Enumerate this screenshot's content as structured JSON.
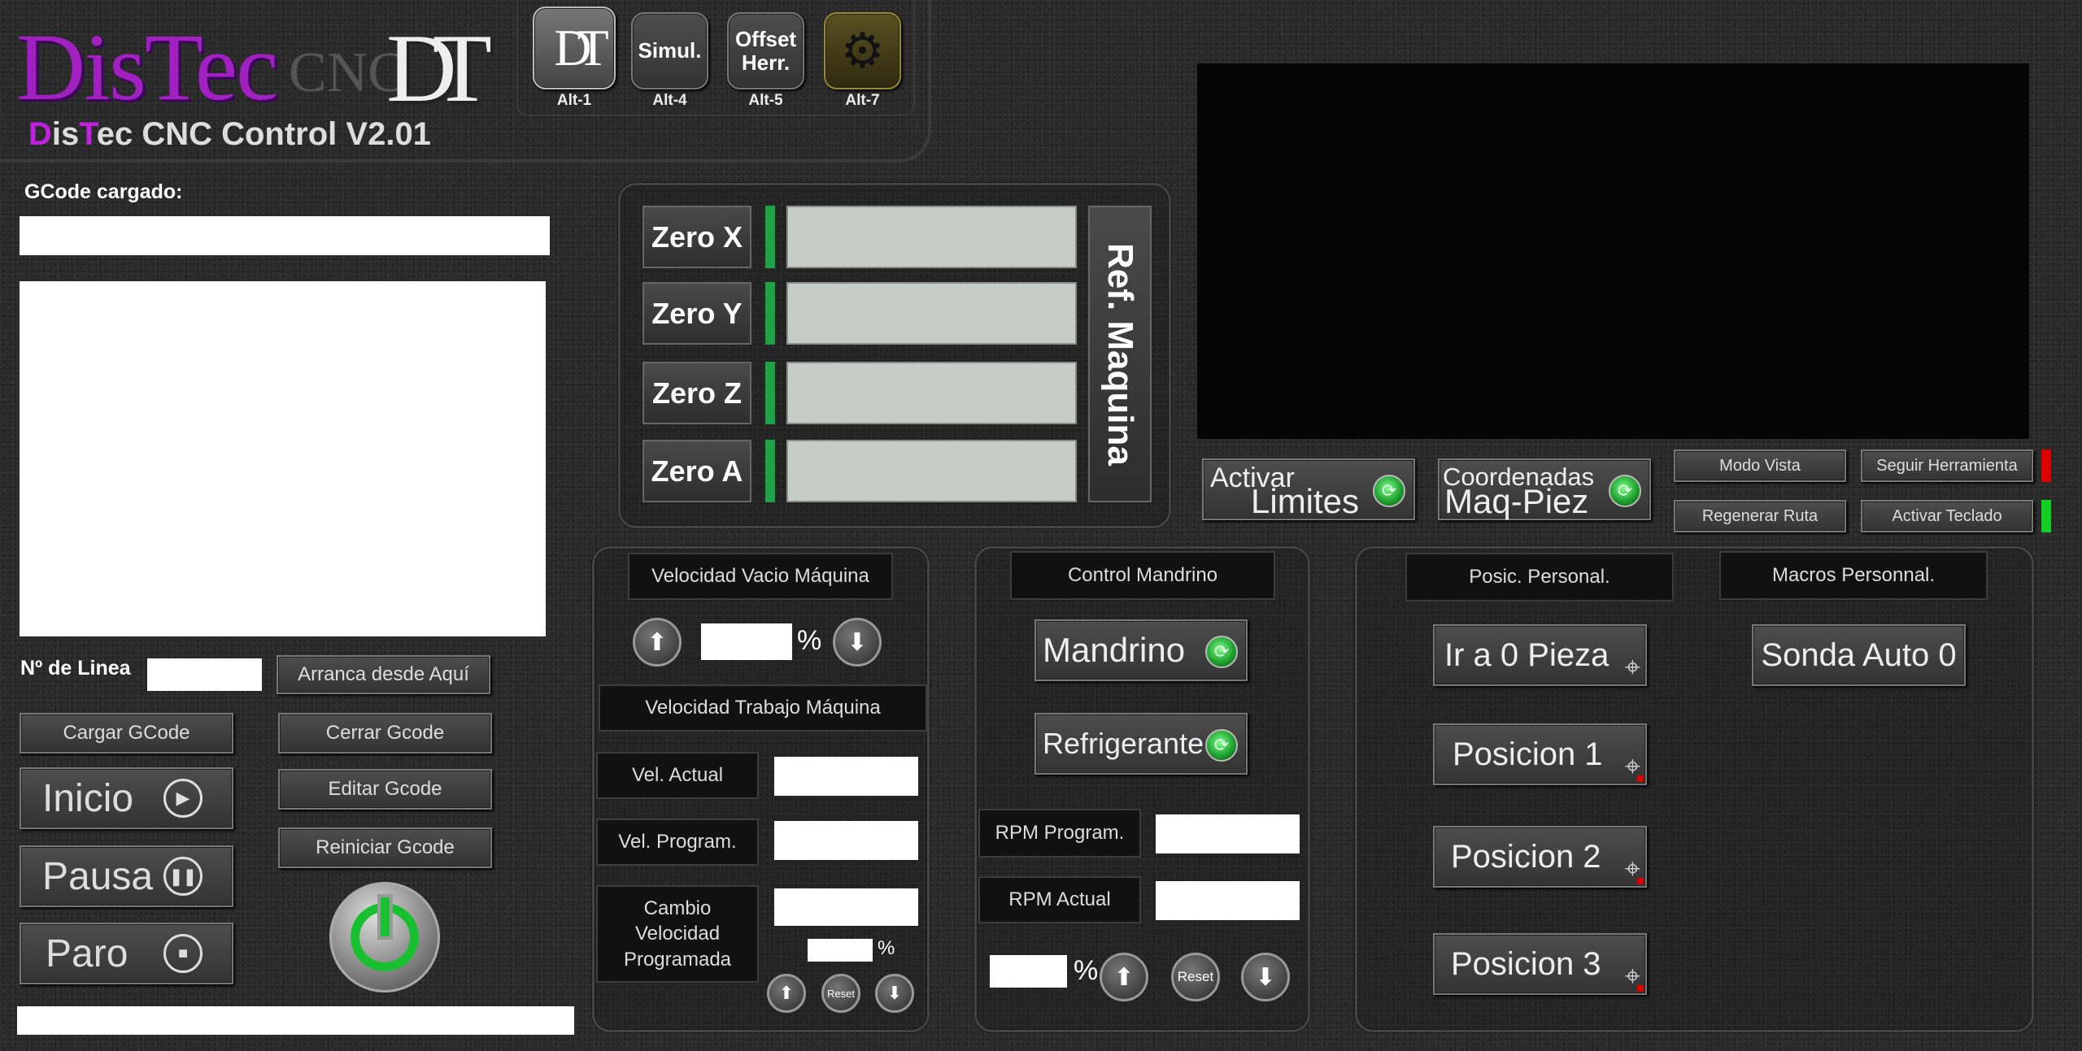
{
  "app": {
    "logo_big": "DisTec",
    "logo_cnc": "CNC",
    "logo_dt": "DT",
    "title_prefix_d": "D",
    "title_prefix_is": "is",
    "title_prefix_t": "T",
    "title_rest": "ec CNC Control V2.01"
  },
  "toolbar": {
    "buttons": [
      {
        "label": "DT",
        "shortcut": "Alt-1"
      },
      {
        "label": "Simul.",
        "shortcut": "Alt-4"
      },
      {
        "label": "Offset Herr.",
        "shortcut": "Alt-5"
      },
      {
        "label": "⚙",
        "shortcut": "Alt-7"
      }
    ]
  },
  "gcode": {
    "loaded_label": "GCode cargado:",
    "line_label": "Nº de Linea",
    "run_from_here": "Arranca desde Aquí",
    "load": "Cargar GCode",
    "close": "Cerrar Gcode",
    "edit": "Editar Gcode",
    "restart": "Reiniciar Gcode",
    "start": "Inicio",
    "pause": "Pausa",
    "stop": "Paro"
  },
  "zero": {
    "axes": [
      "Zero X",
      "Zero Y",
      "Zero Z",
      "Zero A"
    ],
    "ref_machine": "Ref. Maquina"
  },
  "view": {
    "limits_top": "Activar",
    "limits_bottom": "Limites",
    "coords_top": "Coordenadas",
    "coords_bottom": "Maq-Piez",
    "view_mode": "Modo Vista",
    "follow_tool": "Seguir Herramienta",
    "regen_path": "Regenerar Ruta",
    "activate_keyboard": "Activar Teclado",
    "follow_tool_color": "#e00000",
    "keyboard_color": "#10d020"
  },
  "feed": {
    "rapid_title": "Velocidad Vacio Máquina",
    "pct": "%",
    "work_title": "Velocidad Trabajo Máquina",
    "actual": "Vel. Actual",
    "programmed": "Vel. Program.",
    "change_programmed": "Cambio Velocidad Programada",
    "reset": "Reset"
  },
  "spindle": {
    "title": "Control Mandrino",
    "spindle": "Mandrino",
    "coolant": "Refrigerante",
    "rpm_programmed": "RPM Program.",
    "rpm_actual": "RPM Actual",
    "pct": "%",
    "reset": "Reset"
  },
  "positions": {
    "title": "Posic. Personal.",
    "go_zero": "Ir a 0 Pieza",
    "pos1": "Posicion 1",
    "pos2": "Posicion 2",
    "pos3": "Posicion 3"
  },
  "macros": {
    "title": "Macros Personnal.",
    "probe": "Sonda Auto 0"
  }
}
